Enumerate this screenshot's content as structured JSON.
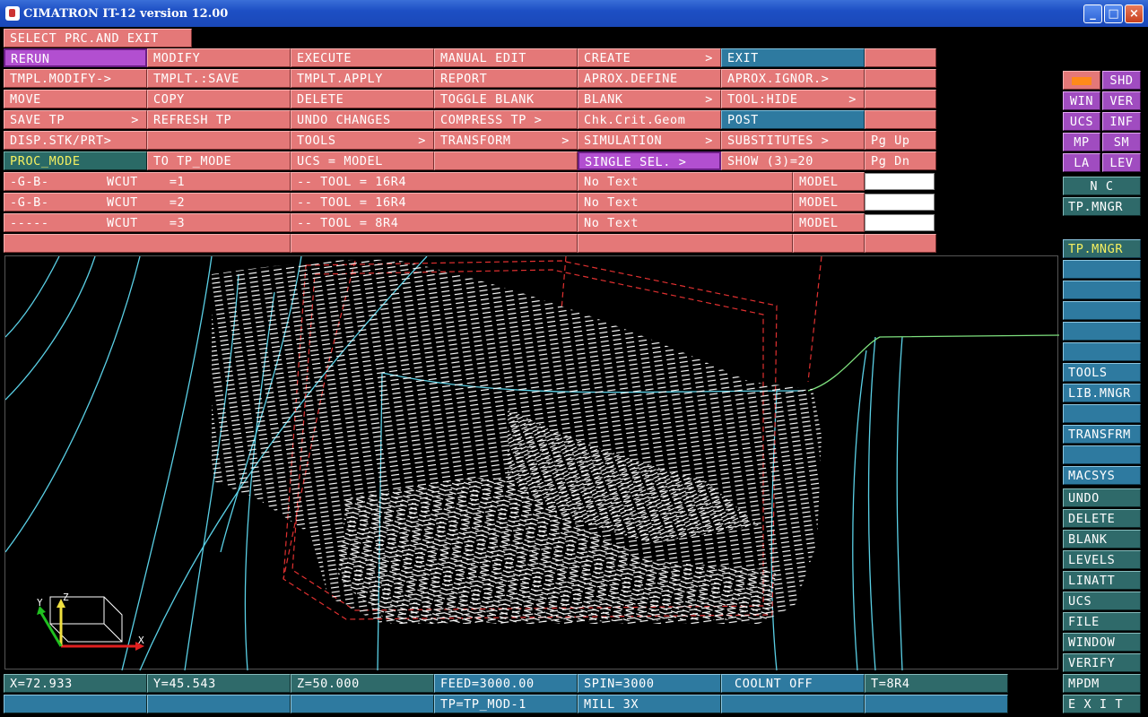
{
  "window": {
    "title": "CIMATRON IT-12 version 12.00"
  },
  "prompt": "SELECT PRC.AND EXIT",
  "menu": [
    [
      "RERUN",
      "MODIFY",
      "EXECUTE",
      "MANUAL EDIT",
      "CREATE",
      "EXIT",
      ""
    ],
    [
      "TMPL.MODIFY->",
      "TMPLT.:SAVE",
      "TMPLT.APPLY",
      "REPORT",
      "APROX.DEFINE",
      "APROX.IGNOR.>",
      ""
    ],
    [
      "MOVE",
      "COPY",
      "DELETE",
      "TOGGLE BLANK",
      "BLANK",
      "TOOL:HIDE",
      ""
    ],
    [
      "SAVE TP",
      "REFRESH TP",
      "UNDO CHANGES",
      "COMPRESS TP >",
      "Chk.Crit.Geom",
      "POST",
      ""
    ],
    [
      "DISP.STK/PRT>",
      "",
      "TOOLS",
      "TRANSFORM",
      "SIMULATION",
      "SUBSTITUTES >",
      "Pg Up"
    ],
    [
      "PROC_MODE",
      "TO TP_MODE",
      "UCS = MODEL",
      "",
      "SINGLE SEL. >",
      "SHOW (3)=20",
      "Pg Dn"
    ]
  ],
  "procs": [
    {
      "seq": "-G-B-",
      "wcut": "WCUT    =1",
      "tool": "-- TOOL = 16R4",
      "text": "No Text",
      "type": "MODEL"
    },
    {
      "seq": "-G-B-",
      "wcut": "WCUT    =2",
      "tool": "-- TOOL = 16R4",
      "text": "No Text",
      "type": "MODEL"
    },
    {
      "seq": "-----",
      "wcut": "WCUT    =3",
      "tool": "-- TOOL = 8R4",
      "text": "No Text",
      "type": "MODEL"
    }
  ],
  "side_top": [
    [
      "",
      "SHD"
    ],
    [
      "WIN",
      "VER"
    ],
    [
      "UCS",
      "INF"
    ],
    [
      "MP",
      "SM"
    ],
    [
      "LA",
      "LEV"
    ]
  ],
  "side_nc": [
    "N C",
    "TP.MNGR"
  ],
  "side_mid": [
    "TP.MNGR",
    "",
    "",
    "",
    "",
    "",
    "TOOLS",
    "LIB.MNGR",
    "",
    "TRANSFRM",
    "",
    "MACSYS"
  ],
  "side_bottom": [
    "UNDO",
    "DELETE",
    "BLANK",
    "LEVELS",
    "LINATT",
    "UCS",
    "FILE",
    "WINDOW",
    "VERIFY",
    "MPDM",
    "E X I T"
  ],
  "status": {
    "x": "X=72.933",
    "y": "Y=45.543",
    "z": "Z=50.000",
    "feed": "FEED=3000.00",
    "spin": "SPIN=3000",
    "coolant": "COOLNT OFF",
    "tool": "T=8R4",
    "tp": "TP=TP_MOD-1",
    "mill": "MILL 3X"
  },
  "axis": {
    "x": "X",
    "y": "Y",
    "z": "Z"
  }
}
